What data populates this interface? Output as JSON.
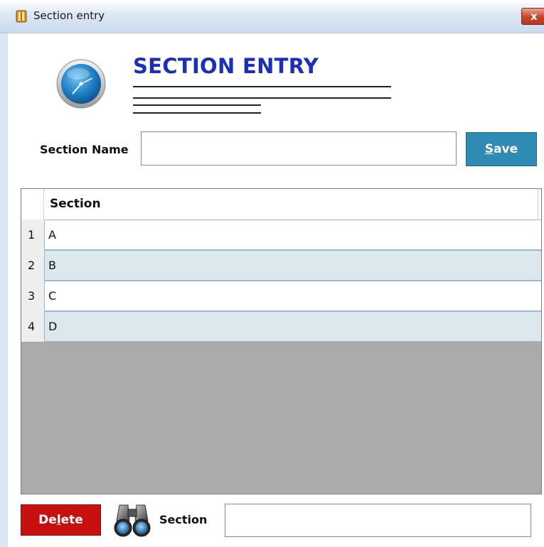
{
  "window": {
    "title": "Section entry",
    "close_label": "x"
  },
  "form": {
    "heading": "SECTION ENTRY",
    "section_name_label": "Section Name",
    "section_name_value": "",
    "save_prefix": "",
    "save_mnemonic": "S",
    "save_rest": "ave"
  },
  "grid": {
    "column_header": "Section",
    "rows": [
      {
        "num": "1",
        "value": "A"
      },
      {
        "num": "2",
        "value": "B"
      },
      {
        "num": "3",
        "value": "C"
      },
      {
        "num": "4",
        "value": "D"
      }
    ]
  },
  "footer": {
    "delete_prefix": "De",
    "delete_mnemonic": "l",
    "delete_rest": "ete",
    "search_label": "Section",
    "search_value": ""
  },
  "colors": {
    "heading": "#1b2fb8",
    "save_button": "#2e8bb3",
    "delete_button": "#c81010",
    "grid_empty": "#ababab",
    "alt_row": "#dde7ee"
  },
  "icons": {
    "app": "app-icon",
    "clock": "clock-icon",
    "search": "binoculars-icon"
  }
}
